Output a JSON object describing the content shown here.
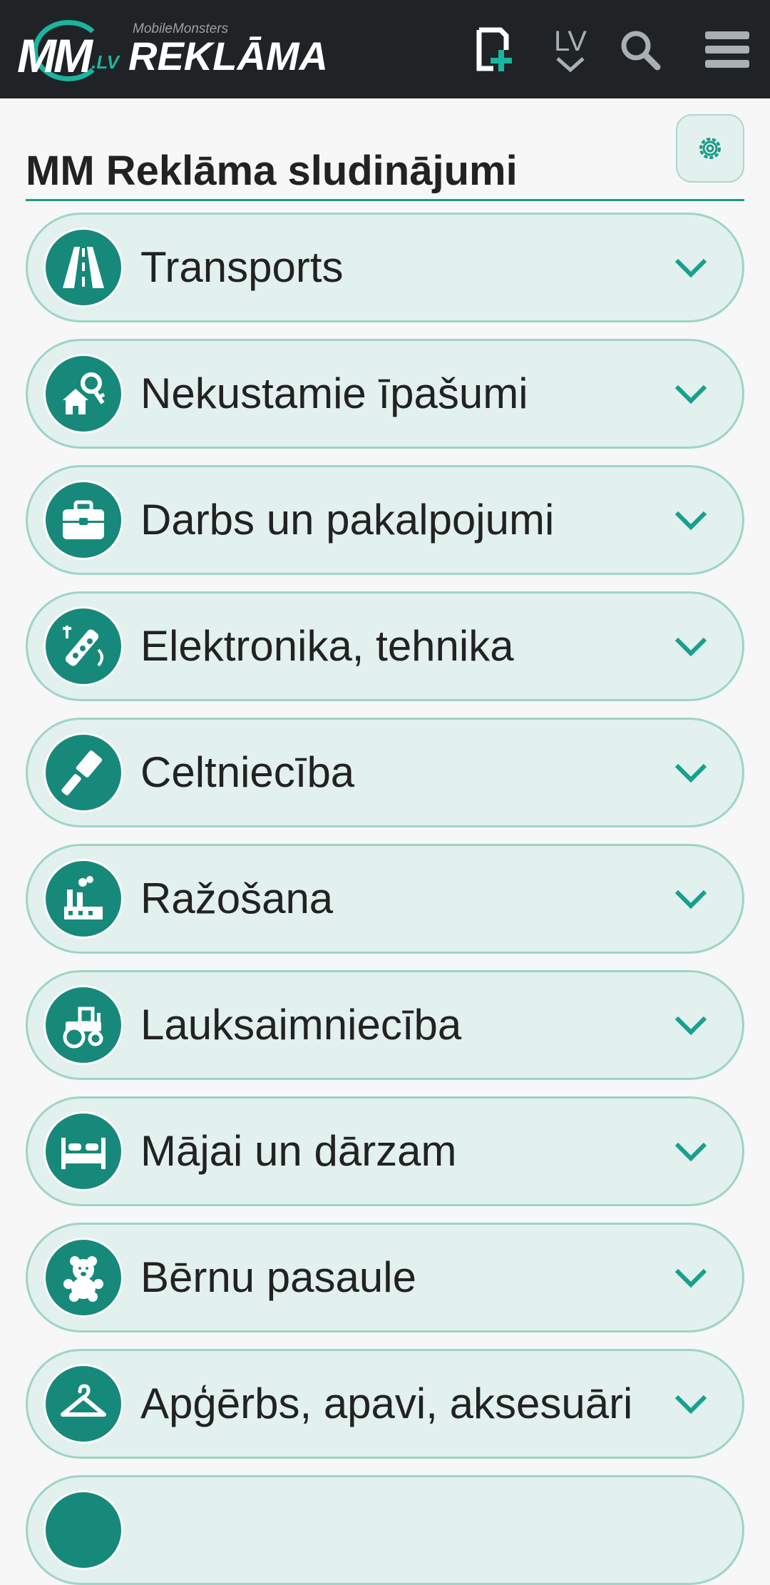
{
  "header": {
    "logo_mm": "MM",
    "logo_lv": ".LV",
    "logo_small": "MobileMonsters",
    "logo_brand": "REKLĀMA",
    "language": "LV"
  },
  "page": {
    "title": "MM Reklāma sludinājumi"
  },
  "categories": [
    {
      "label": "Transports",
      "icon": "road-icon"
    },
    {
      "label": "Nekustamie īpašumi",
      "icon": "house-key-icon"
    },
    {
      "label": "Darbs un pakalpojumi",
      "icon": "briefcase-icon"
    },
    {
      "label": "Elektronika, tehnika",
      "icon": "power-strip-icon"
    },
    {
      "label": "Celtniecība",
      "icon": "paint-roller-icon"
    },
    {
      "label": "Ražošana",
      "icon": "factory-icon"
    },
    {
      "label": "Lauksaimniecība",
      "icon": "tractor-icon"
    },
    {
      "label": "Mājai un dārzam",
      "icon": "bed-icon"
    },
    {
      "label": "Bērnu pasaule",
      "icon": "teddy-bear-icon"
    },
    {
      "label": "Apģērbs, apavi, aksesuāri",
      "icon": "hanger-icon"
    }
  ],
  "colors": {
    "header_bg": "#202326",
    "accent": "#1ab5a0",
    "icon_bg": "#17897a",
    "card_bg": "#e2f0ee",
    "card_border": "#9dd5c8"
  }
}
